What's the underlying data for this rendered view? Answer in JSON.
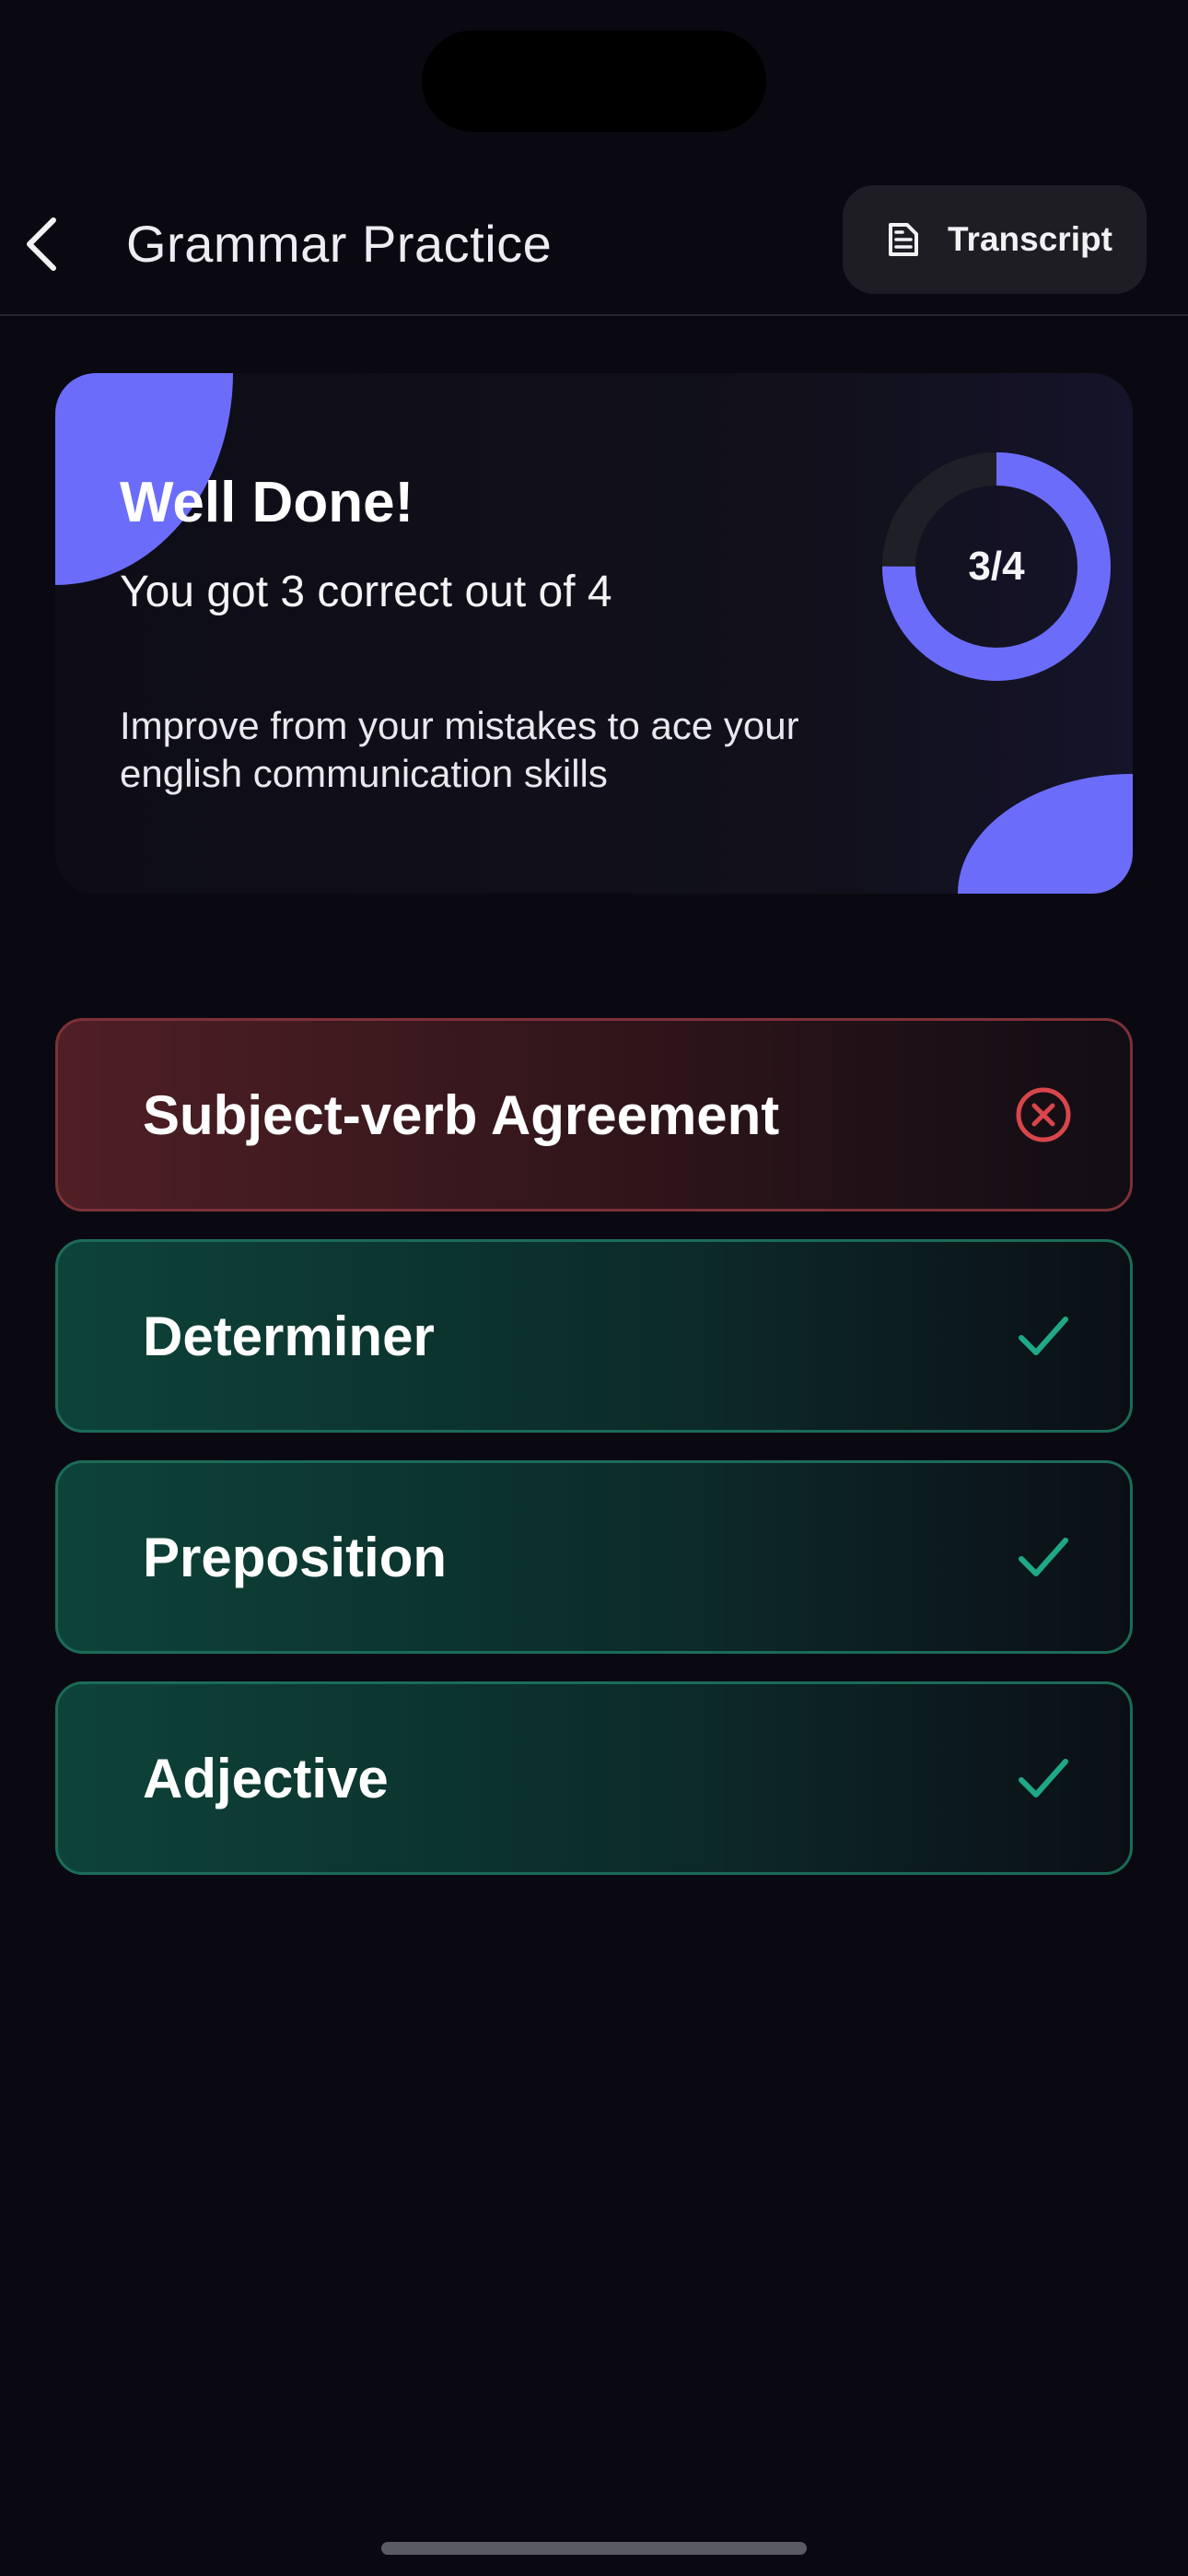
{
  "header": {
    "title": "Grammar Practice",
    "transcript_label": "Transcript"
  },
  "score_card": {
    "title": "Well Done!",
    "subtitle": "You got 3 correct out of 4",
    "message": "Improve from your mistakes to ace your english communication skills",
    "score_text": "3/4",
    "correct": 3,
    "total": 4
  },
  "results": [
    {
      "label": "Subject-verb Agreement",
      "status": "wrong",
      "icon": "x-circle-icon"
    },
    {
      "label": "Determiner",
      "status": "correct",
      "icon": "check-icon"
    },
    {
      "label": "Preposition",
      "status": "correct",
      "icon": "check-icon"
    },
    {
      "label": "Adjective",
      "status": "correct",
      "icon": "check-icon"
    }
  ],
  "colors": {
    "background": "#0a0911",
    "accent": "#6b6dfa",
    "wrong": "#d8464c",
    "correct": "#1fa887"
  }
}
